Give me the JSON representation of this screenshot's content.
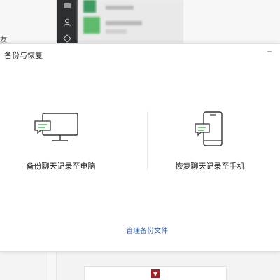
{
  "background": {
    "left_glyph": "友"
  },
  "dialog": {
    "title": "备份与恢复",
    "minimize_label": "-",
    "options": [
      {
        "label": "备份聊天记录至电脑",
        "icon": "monitor-chat-icon"
      },
      {
        "label": "恢复聊天记录至手机",
        "icon": "phone-chat-icon"
      }
    ],
    "manage_link": "管理备份文件"
  },
  "colors": {
    "accent_green": "#5dbb6b",
    "link_blue": "#2e5a9c",
    "rail_dark": "#2d2f31"
  }
}
